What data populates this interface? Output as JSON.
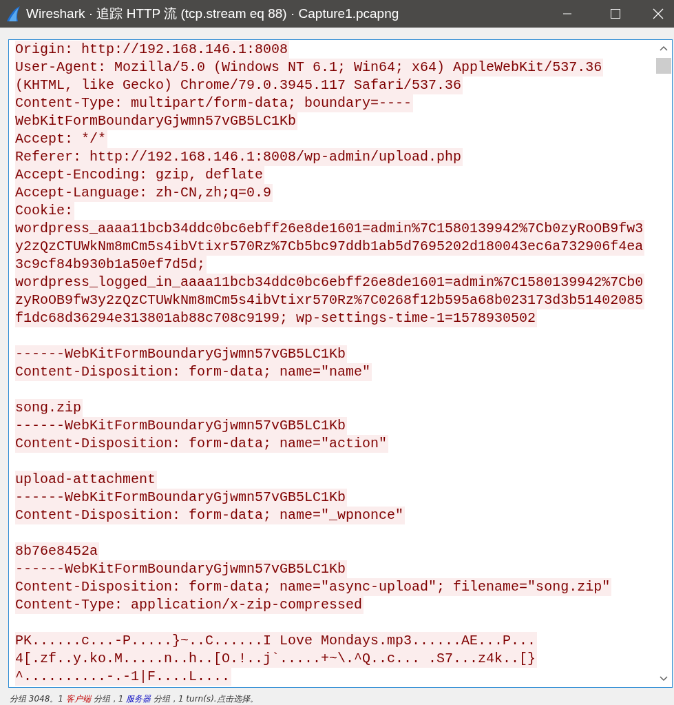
{
  "window": {
    "title": "Wireshark · 追踪 HTTP 流 (tcp.stream eq 88) · Capture1.pcapng"
  },
  "stream": {
    "lines": [
      {
        "kind": "client",
        "text": "Origin: http://192.168.146.1:8008"
      },
      {
        "kind": "client",
        "text": "User-Agent: Mozilla/5.0 (Windows NT 6.1; Win64; x64) AppleWebKit/537.36"
      },
      {
        "kind": "client",
        "text": "(KHTML, like Gecko) Chrome/79.0.3945.117 Safari/537.36"
      },
      {
        "kind": "client",
        "text": "Content-Type: multipart/form-data; boundary=----"
      },
      {
        "kind": "client",
        "text": "WebKitFormBoundaryGjwmn57vGB5LC1Kb"
      },
      {
        "kind": "client",
        "text": "Accept: */*"
      },
      {
        "kind": "client",
        "text": "Referer: http://192.168.146.1:8008/wp-admin/upload.php"
      },
      {
        "kind": "client",
        "text": "Accept-Encoding: gzip, deflate"
      },
      {
        "kind": "client",
        "text": "Accept-Language: zh-CN,zh;q=0.9"
      },
      {
        "kind": "client",
        "text": "Cookie:"
      },
      {
        "kind": "client",
        "text": "wordpress_aaaa11bcb34ddc0bc6ebff26e8de1601=admin%7C1580139942%7Cb0zyRoOB9fw3"
      },
      {
        "kind": "client",
        "text": "y2zQzCTUWkNm8mCm5s4ibVtixr570Rz%7Cb5bc97ddb1ab5d7695202d180043ec6a732906f4ea"
      },
      {
        "kind": "client",
        "text": "3c9cf84b930b1a50ef7d5d;"
      },
      {
        "kind": "client",
        "text": "wordpress_logged_in_aaaa11bcb34ddc0bc6ebff26e8de1601=admin%7C1580139942%7Cb0"
      },
      {
        "kind": "client",
        "text": "zyRoOB9fw3y2zQzCTUWkNm8mCm5s4ibVtixr570Rz%7C0268f12b595a68b023173d3b51402085"
      },
      {
        "kind": "client",
        "text": "f1dc68d36294e313801ab88c708c9199; wp-settings-time-1=1578930502"
      },
      {
        "kind": "blank"
      },
      {
        "kind": "client",
        "text": "------WebKitFormBoundaryGjwmn57vGB5LC1Kb"
      },
      {
        "kind": "client",
        "text": "Content-Disposition: form-data; name=\"name\""
      },
      {
        "kind": "blank"
      },
      {
        "kind": "client",
        "text": "song.zip"
      },
      {
        "kind": "client",
        "text": "------WebKitFormBoundaryGjwmn57vGB5LC1Kb"
      },
      {
        "kind": "client",
        "text": "Content-Disposition: form-data; name=\"action\""
      },
      {
        "kind": "blank"
      },
      {
        "kind": "client",
        "text": "upload-attachment"
      },
      {
        "kind": "client",
        "text": "------WebKitFormBoundaryGjwmn57vGB5LC1Kb"
      },
      {
        "kind": "client",
        "text": "Content-Disposition: form-data; name=\"_wpnonce\""
      },
      {
        "kind": "blank"
      },
      {
        "kind": "client",
        "text": "8b76e8452a"
      },
      {
        "kind": "client",
        "text": "------WebKitFormBoundaryGjwmn57vGB5LC1Kb"
      },
      {
        "kind": "client",
        "text": "Content-Disposition: form-data; name=\"async-upload\"; filename=\"song.zip\""
      },
      {
        "kind": "client",
        "text": "Content-Type: application/x-zip-compressed"
      },
      {
        "kind": "blank"
      },
      {
        "kind": "client",
        "text": "PK......c...-P.....}~..C......I Love Mondays.mp3......AE...P..."
      },
      {
        "kind": "client",
        "text": "4[.zf..y.ko.M.....n..h..[O.!..j`.....+~\\.^Q..c... .S7...z4k..[}"
      },
      {
        "kind": "client",
        "text": "^..........-.-1|F....L...."
      }
    ]
  },
  "status_bar": {
    "parts": [
      {
        "kind": "plain",
        "text": "分组 3048。1 "
      },
      {
        "kind": "client",
        "text": "客户端"
      },
      {
        "kind": "plain",
        "text": " 分组，1 "
      },
      {
        "kind": "server",
        "text": "服务器"
      },
      {
        "kind": "plain",
        "text": " 分组，1 turn(s).点击选择。"
      }
    ]
  }
}
